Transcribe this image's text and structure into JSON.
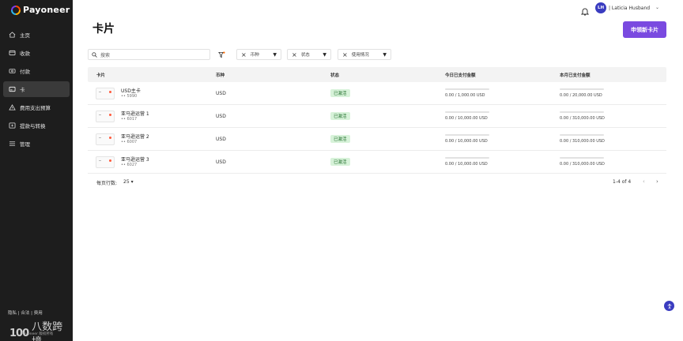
{
  "brand": {
    "logo_text": "Payoneer"
  },
  "sidebar": {
    "items": [
      {
        "label": "主页",
        "icon": "home-icon",
        "active": false
      },
      {
        "label": "收款",
        "icon": "receive-icon",
        "active": false
      },
      {
        "label": "付款",
        "icon": "pay-icon",
        "active": false
      },
      {
        "label": "卡",
        "icon": "card-icon",
        "active": true
      },
      {
        "label": "费用支出预算",
        "icon": "budget-icon",
        "active": false
      },
      {
        "label": "提款与转换",
        "icon": "withdraw-icon",
        "active": false
      },
      {
        "label": "管理",
        "icon": "manage-icon",
        "active": false
      }
    ],
    "footer_links": "隐私 | 合法 | 费用"
  },
  "watermark": {
    "logo": "100",
    "text": "八数跨境",
    "small": "Payoneer 版权所有"
  },
  "topbar": {
    "avatar_initials": "LH",
    "user_name": "| Laticia Husband"
  },
  "header": {
    "title": "卡片",
    "new_card_label": "申领新卡片"
  },
  "filters": {
    "search_placeholder": "搜索",
    "chips": [
      {
        "label": "币种"
      },
      {
        "label": "状态"
      },
      {
        "label": "使用情况"
      }
    ]
  },
  "table": {
    "columns": [
      "卡片",
      "币种",
      "状态",
      "今日已支付金额",
      "本月已支付金额"
    ],
    "rows": [
      {
        "name": "USD主卡",
        "number": "•• 5990",
        "currency": "USD",
        "status": "已激活",
        "today": "0.00 / 1,000.00 USD",
        "today_ratio": 0,
        "month": "0.00 / 20,000.00 USD",
        "month_ratio": 0
      },
      {
        "name": "亚马逊运营 1",
        "number": "•• 6017",
        "currency": "USD",
        "status": "已激活",
        "today": "0.00 / 10,000.00 USD",
        "today_ratio": 0,
        "month": "0.00 / 310,000.00 USD",
        "month_ratio": 0
      },
      {
        "name": "亚马逊运营 2",
        "number": "•• 6007",
        "currency": "USD",
        "status": "已激活",
        "today": "0.00 / 10,000.00 USD",
        "today_ratio": 0,
        "month": "0.00 / 310,000.00 USD",
        "month_ratio": 0
      },
      {
        "name": "亚马逊运营 3",
        "number": "•• 6027",
        "currency": "USD",
        "status": "已激活",
        "today": "0.00 / 10,000.00 USD",
        "today_ratio": 0,
        "month": "0.00 / 310,000.00 USD",
        "month_ratio": 0
      }
    ]
  },
  "pagination": {
    "rows_per_page_label": "每页行数:",
    "rows_per_page_value": "25",
    "range": "1-4 of 4"
  },
  "colors": {
    "accent": "#7a4ae0",
    "status_bg": "#d7f2d9",
    "sidebar_bg": "#1d1d1d"
  }
}
